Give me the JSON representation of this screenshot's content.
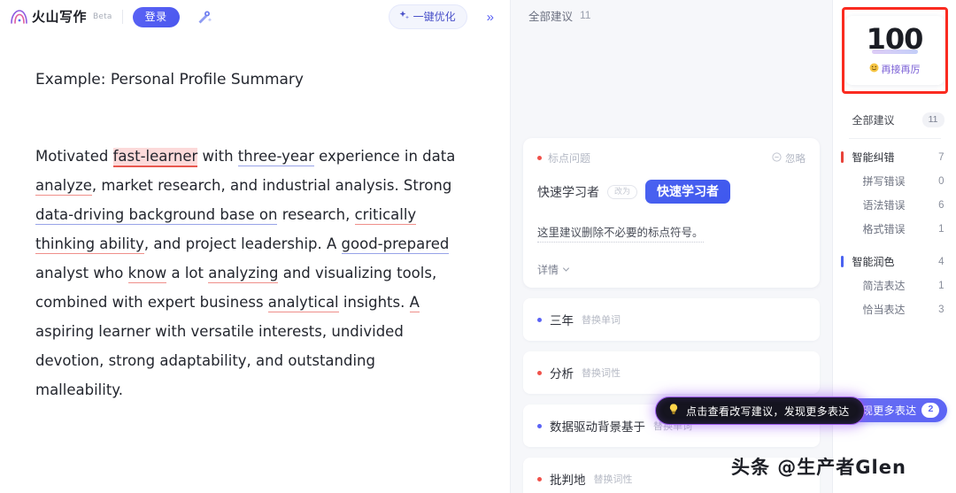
{
  "header": {
    "brand_name": "火山写作",
    "brand_mark_icon": "volcano-logo-icon",
    "beta_tag": "Beta",
    "login_label": "登录",
    "magic_icon": "magic-wand-icon",
    "optimize_label": "一键优化",
    "optimize_icon": "sparkle-icon",
    "expand_icon": "double-chevron-right-icon",
    "expand_label": "»"
  },
  "document": {
    "title": "Example: Personal Profile Summary",
    "paragraph_parts": [
      {
        "text": "Motivated ",
        "style": "plain"
      },
      {
        "text": "fast-learner",
        "style": "hl-red"
      },
      {
        "text": " with ",
        "style": "plain"
      },
      {
        "text": "three-year",
        "style": "u-blue"
      },
      {
        "text": " experience in data ",
        "style": "plain"
      },
      {
        "text": "analyze",
        "style": "u-red"
      },
      {
        "text": ", market research, and industrial analysis. Strong ",
        "style": "plain"
      },
      {
        "text": "data-driving background base on",
        "style": "u-blue"
      },
      {
        "text": " research, ",
        "style": "plain"
      },
      {
        "text": "critically thinking ability",
        "style": "u-red"
      },
      {
        "text": ", and project leadership. A ",
        "style": "plain"
      },
      {
        "text": "good-prepared",
        "style": "u-blue"
      },
      {
        "text": " analyst who ",
        "style": "plain"
      },
      {
        "text": "know",
        "style": "u-red"
      },
      {
        "text": " a lot ",
        "style": "plain"
      },
      {
        "text": "analyzing",
        "style": "u-red"
      },
      {
        "text": " and visualizing tools, combined with expert business ",
        "style": "plain"
      },
      {
        "text": "analytical",
        "style": "u-red"
      },
      {
        "text": " insights. ",
        "style": "plain"
      },
      {
        "text": "A",
        "style": "u-red"
      },
      {
        "text": " aspiring learner with versatile interests, undivided devotion, strong adaptability, and outstanding malleability.",
        "style": "plain"
      }
    ]
  },
  "suggestions": {
    "header_label": "全部建议",
    "header_count": "11",
    "card": {
      "type_label": "标点问题",
      "type_dot": "red",
      "ignore_label": "忽略",
      "ignore_icon": "minus-circle-icon",
      "old_word": "快速学习者",
      "arrow_label": "改为",
      "new_word": "快速学习者",
      "description": "这里建议删除不必要的标点符号。",
      "detail_label": "详情",
      "detail_icon": "chevron-down-icon"
    },
    "items": [
      {
        "word": "三年",
        "tag": "替换单词",
        "dot": "blue"
      },
      {
        "word": "分析",
        "tag": "替换词性",
        "dot": "red"
      },
      {
        "word": "数据驱动背景基于",
        "tag": "替换单词",
        "dot": "blue"
      },
      {
        "word": "批判地",
        "tag": "替换词性",
        "dot": "red"
      }
    ]
  },
  "tooltip": {
    "icon": "lightbulb-icon",
    "text": "点击查看改写建议，发现更多表达"
  },
  "sidebar": {
    "score": {
      "value": "100",
      "caption": "再接再厉",
      "caption_icon": "smiley-face-icon"
    },
    "rows": [
      {
        "label": "全部建议",
        "count": "11",
        "kind": "all",
        "bar": ""
      },
      {
        "label": "智能纠错",
        "count": "7",
        "kind": "group",
        "bar": "red"
      },
      {
        "label": "拼写错误",
        "count": "0",
        "kind": "sub",
        "bar": ""
      },
      {
        "label": "语法错误",
        "count": "6",
        "kind": "sub",
        "bar": ""
      },
      {
        "label": "格式错误",
        "count": "1",
        "kind": "sub",
        "bar": ""
      },
      {
        "label": "智能润色",
        "count": "4",
        "kind": "group",
        "bar": "blue"
      },
      {
        "label": "简洁表达",
        "count": "1",
        "kind": "sub",
        "bar": ""
      },
      {
        "label": "恰当表达",
        "count": "3",
        "kind": "sub",
        "bar": ""
      }
    ],
    "discover": {
      "label": "发现更多表达",
      "badge": "2"
    }
  },
  "watermark": {
    "text": "头条 @生产者Glen"
  },
  "colors": {
    "accent_purple": "#5b63f5",
    "error_red": "#e8433a",
    "highlight_pink": "#fcdada",
    "tooltip_border": "#9d5bf0",
    "annotation_red": "#fa2b20"
  }
}
